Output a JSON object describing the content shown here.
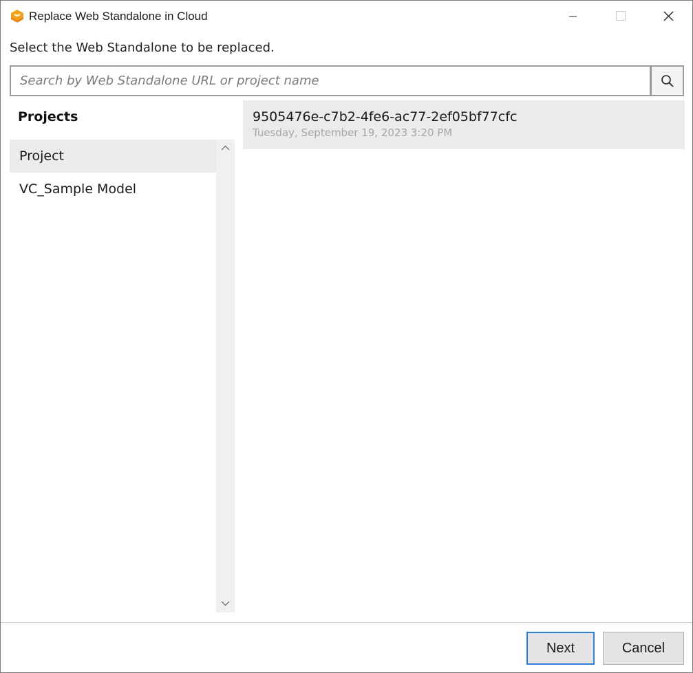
{
  "window": {
    "title": "Replace Web Standalone in Cloud",
    "app_icon": "standalone-logo-icon",
    "controls": [
      "minimize-icon",
      "maximize-icon",
      "close-icon"
    ]
  },
  "instruction": "Select the Web Standalone to be replaced.",
  "search": {
    "value": "",
    "placeholder": "Search by Web Standalone URL or project name",
    "button_icon": "search-icon"
  },
  "projects": {
    "header": "Projects",
    "items": [
      {
        "label": "Project",
        "selected": true
      },
      {
        "label": "VC_Sample Model",
        "selected": false
      }
    ]
  },
  "standalones": [
    {
      "id": "9505476e-c7b2-4fe6-ac77-2ef05bf77cfc",
      "date": "Tuesday, September 19, 2023 3:20 PM",
      "selected": true
    }
  ],
  "footer": {
    "next_label": "Next",
    "cancel_label": "Cancel"
  },
  "colors": {
    "accent": "#2f7fd4",
    "brand_orange": "#f5a21b",
    "selection_bg": "#ebebeb"
  }
}
